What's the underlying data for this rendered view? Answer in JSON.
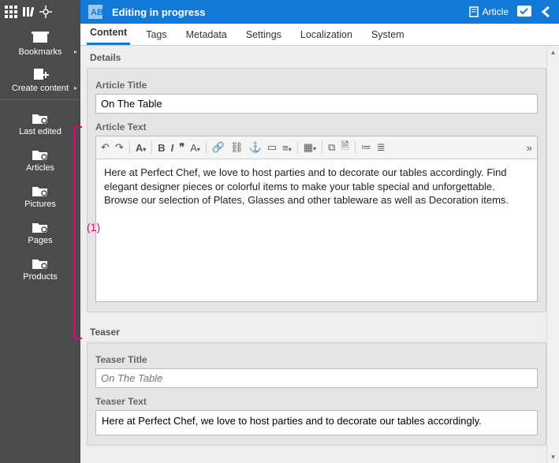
{
  "topbar": {
    "title": "Editing in progress",
    "article_label": "Article"
  },
  "sidebar": {
    "items": [
      {
        "label": "Bookmarks"
      },
      {
        "label": "Create content"
      },
      {
        "label": "Last edited"
      },
      {
        "label": "Articles"
      },
      {
        "label": "Pictures"
      },
      {
        "label": "Pages"
      },
      {
        "label": "Products"
      }
    ]
  },
  "tabs": [
    "Content",
    "Tags",
    "Metadata",
    "Settings",
    "Localization",
    "System"
  ],
  "sections": {
    "details": "Details",
    "teaser": "Teaser"
  },
  "fields": {
    "article_title_label": "Article Title",
    "article_title_value": "On The Table",
    "article_text_label": "Article Text",
    "article_text_value": "Here at Perfect Chef, we love to host parties and to decorate our tables accordingly. Find elegant designer pieces or colorful items to make your table special and unforgettable. Browse our selection of Plates, Glasses and other tableware as well as Decoration items.",
    "teaser_title_label": "Teaser Title",
    "teaser_title_placeholder": "On The Table",
    "teaser_text_label": "Teaser Text",
    "teaser_text_value": "Here at Perfect Chef, we love to host parties and to decorate our tables accordingly."
  },
  "annotation": {
    "label": "(1)"
  }
}
